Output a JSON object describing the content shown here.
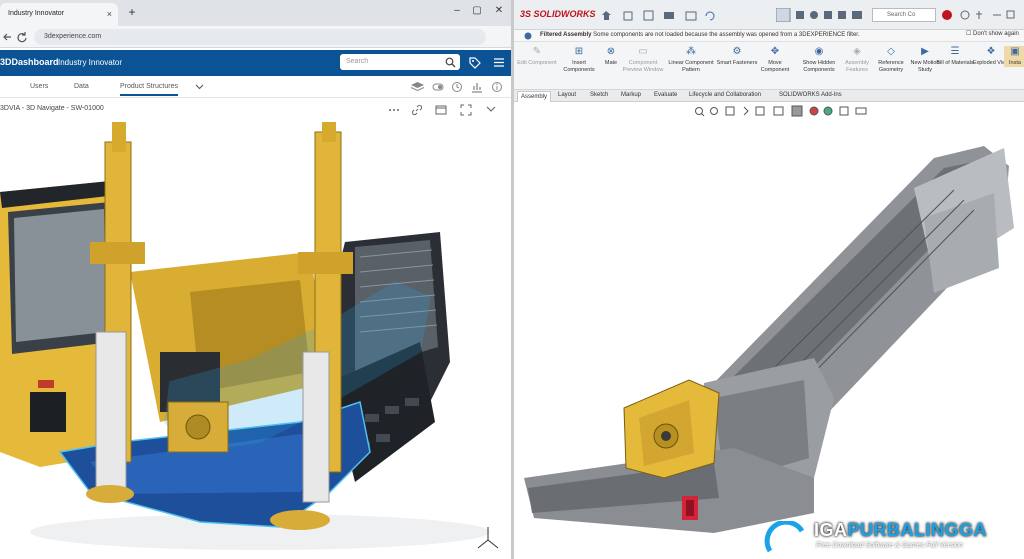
{
  "browser": {
    "tab_title": "Industry Innovator",
    "tab_close": "×",
    "new_tab": "+",
    "url": "3dexperience.com",
    "window_controls": [
      "–",
      "▢",
      "✕"
    ]
  },
  "dashboard": {
    "brand": "3DDashboard",
    "app_name": "Industry Innovator",
    "search_placeholder": "Search",
    "tabs": [
      "Users",
      "Data",
      "Product Structures"
    ],
    "active_tab": "Product Structures",
    "panel_title": "3DVIA - 3D Navigate - SW-01000"
  },
  "solidworks": {
    "logo": "3S SOLIDWORKS",
    "search_placeholder": "Search Co",
    "filtered_label": "Filtered Assembly",
    "filtered_message": "Some components are not loaded because the assembly was opened from a 3DEXPERIENCE filter.",
    "dont_show": "Don't show again",
    "commands": [
      {
        "label": "Edit Component",
        "disabled": true,
        "icon": "edit-component-icon"
      },
      {
        "label": "Insert Components",
        "disabled": false,
        "icon": "insert-components-icon"
      },
      {
        "label": "Mate",
        "disabled": false,
        "icon": "mate-icon"
      },
      {
        "label": "Component Preview Window",
        "disabled": true,
        "icon": "preview-window-icon"
      },
      {
        "label": "Linear Component Pattern",
        "disabled": false,
        "icon": "pattern-icon"
      },
      {
        "label": "Smart Fasteners",
        "disabled": false,
        "icon": "fasteners-icon"
      },
      {
        "label": "Move Component",
        "disabled": false,
        "icon": "move-component-icon"
      },
      {
        "label": "Show Hidden Components",
        "disabled": false,
        "icon": "show-hidden-icon"
      },
      {
        "label": "Assembly Features",
        "disabled": true,
        "icon": "assembly-features-icon"
      },
      {
        "label": "Reference Geometry",
        "disabled": false,
        "icon": "reference-geometry-icon"
      },
      {
        "label": "New Motion Study",
        "disabled": false,
        "icon": "motion-study-icon"
      },
      {
        "label": "Bill of Materials",
        "disabled": false,
        "icon": "bom-icon"
      },
      {
        "label": "Exploded View",
        "disabled": false,
        "icon": "exploded-view-icon"
      },
      {
        "label": "Insta",
        "disabled": false,
        "icon": "instant3d-icon"
      }
    ],
    "tabs": [
      "Assembly",
      "Layout",
      "Sketch",
      "Markup",
      "Evaluate",
      "Lifecycle and Collaboration",
      "SOLIDWORKS Add-Ins"
    ],
    "active_tab": "Assembly"
  },
  "watermark": {
    "name_a": "IGA",
    "name_b": "PURBALINGGA",
    "tagline": "Free Download Software & Games Full Version"
  },
  "colors": {
    "dashboard_blue": "#0b5394",
    "machine_yellow": "#e5b93a",
    "chassis_blue": "#1d4f9b",
    "highlight_cyan": "#2ba6e6",
    "sw_red": "#c1121f"
  }
}
